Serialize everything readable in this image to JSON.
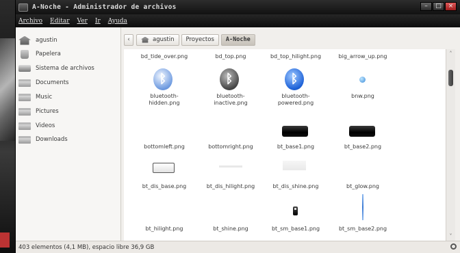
{
  "window": {
    "title": "A-Noche - Administrador de archivos",
    "controls": {
      "minimize": "–",
      "maximize": "□",
      "close": "×"
    }
  },
  "menubar": {
    "items": [
      "Archivo",
      "Editar",
      "Ver",
      "Ir",
      "Ayuda"
    ]
  },
  "sidebar": {
    "items": [
      {
        "label": "agustin",
        "icon": "home-icon"
      },
      {
        "label": "Papelera",
        "icon": "trash-icon"
      },
      {
        "label": "Sistema de archivos",
        "icon": "drive-icon"
      },
      {
        "label": "Documents",
        "icon": "folder-icon"
      },
      {
        "label": "Music",
        "icon": "folder-icon"
      },
      {
        "label": "Pictures",
        "icon": "folder-icon"
      },
      {
        "label": "Videos",
        "icon": "folder-icon"
      },
      {
        "label": "Downloads",
        "icon": "folder-icon"
      }
    ]
  },
  "location": {
    "back": "‹",
    "crumbs": [
      "agustin",
      "Proyectos",
      "A-Noche"
    ]
  },
  "files": [
    {
      "name": "bd_tide_over.png"
    },
    {
      "name": "bd_top.png"
    },
    {
      "name": "bd_top_hilight.png"
    },
    {
      "name": "big_arrow_up.png"
    },
    {
      "name": "bluetooth-\nhidden.png",
      "icon": "bluetooth-light-icon"
    },
    {
      "name": "bluetooth-\ninactive.png",
      "icon": "bluetooth-dark-icon"
    },
    {
      "name": "bluetooth-\npowered.png",
      "icon": "bluetooth-blue-icon"
    },
    {
      "name": "bnw.png",
      "icon": "globe-icon"
    },
    {
      "name": "bottomleft.png"
    },
    {
      "name": "bottomright.png"
    },
    {
      "name": "bt_base1.png",
      "icon": "black-bar-icon"
    },
    {
      "name": "bt_base2.png",
      "icon": "black-bar-icon"
    },
    {
      "name": "bt_dis_base.png",
      "icon": "white-box-icon"
    },
    {
      "name": "bt_dis_hilight.png",
      "icon": "faint-bar-icon"
    },
    {
      "name": "bt_dis_shine.png",
      "icon": "faint-box-icon"
    },
    {
      "name": "bt_glow.png"
    },
    {
      "name": "bt_hilight.png"
    },
    {
      "name": "bt_shine.png"
    },
    {
      "name": "bt_sm_base1.png",
      "icon": "small-bar-icon"
    },
    {
      "name": "bt_sm_base2.png",
      "icon": "vertical-line-icon"
    }
  ],
  "bluetooth_glyph": "ᛒ",
  "scroll": {
    "up": "˄",
    "down": "˅"
  },
  "status": {
    "text": "403 elementos (4,1 MB), espacio libre 36,9 GB"
  }
}
